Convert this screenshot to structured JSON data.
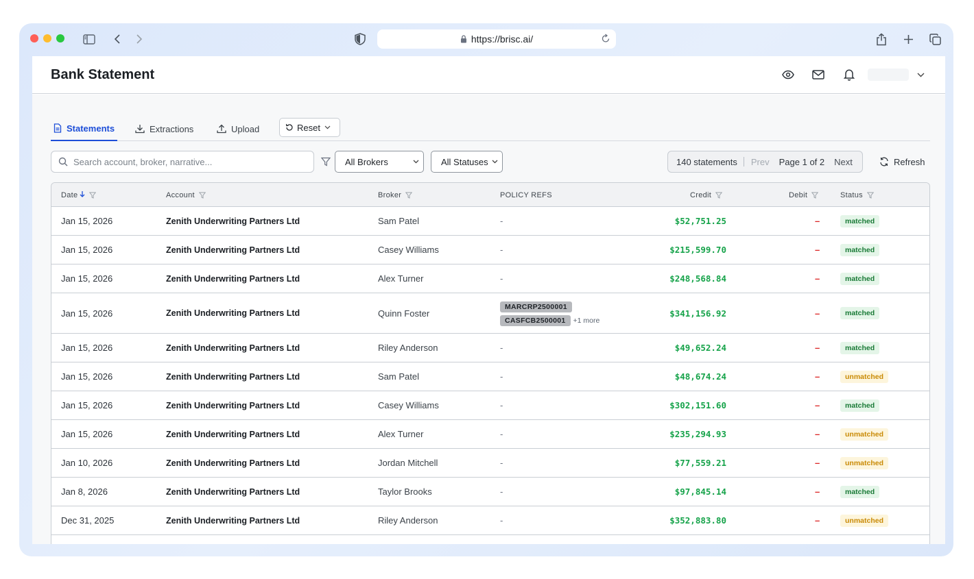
{
  "browser": {
    "url": "https://brisc.ai/"
  },
  "header": {
    "title": "Bank Statement"
  },
  "tabs": [
    {
      "label": "Statements",
      "active": true
    },
    {
      "label": "Extractions",
      "active": false
    },
    {
      "label": "Upload",
      "active": false
    }
  ],
  "toolbar": {
    "reset_label": "Reset",
    "search_placeholder": "Search account, broker, narrative...",
    "broker_filter": "All Brokers",
    "status_filter": "All Statuses",
    "statement_count": "140 statements",
    "prev_label": "Prev",
    "page_label": "Page 1 of 2",
    "next_label": "Next",
    "refresh_label": "Refresh"
  },
  "table": {
    "columns": {
      "date": "Date",
      "account": "Account",
      "broker": "Broker",
      "policy_refs": "POLICY REFS",
      "credit": "Credit",
      "debit": "Debit",
      "status": "Status"
    },
    "rows": [
      {
        "date": "Jan 15, 2026",
        "account": "Zenith Underwriting Partners Ltd",
        "broker": "Sam Patel",
        "policy": "-",
        "credit": "$52,751.25",
        "debit": "–",
        "status": "matched"
      },
      {
        "date": "Jan 15, 2026",
        "account": "Zenith Underwriting Partners Ltd",
        "broker": "Casey Williams",
        "policy": "-",
        "credit": "$215,599.70",
        "debit": "–",
        "status": "matched"
      },
      {
        "date": "Jan 15, 2026",
        "account": "Zenith Underwriting Partners Ltd",
        "broker": "Alex Turner",
        "policy": "-",
        "credit": "$248,568.84",
        "debit": "–",
        "status": "matched"
      },
      {
        "date": "Jan 15, 2026",
        "account": "Zenith Underwriting Partners Ltd",
        "broker": "Quinn Foster",
        "policy_refs": [
          "MARCRP2500001",
          "CASFCB2500001"
        ],
        "policy_more": "+1 more",
        "credit": "$341,156.92",
        "debit": "–",
        "status": "matched"
      },
      {
        "date": "Jan 15, 2026",
        "account": "Zenith Underwriting Partners Ltd",
        "broker": "Riley Anderson",
        "policy": "-",
        "credit": "$49,652.24",
        "debit": "–",
        "status": "matched"
      },
      {
        "date": "Jan 15, 2026",
        "account": "Zenith Underwriting Partners Ltd",
        "broker": "Sam Patel",
        "policy": "-",
        "credit": "$48,674.24",
        "debit": "–",
        "status": "unmatched"
      },
      {
        "date": "Jan 15, 2026",
        "account": "Zenith Underwriting Partners Ltd",
        "broker": "Casey Williams",
        "policy": "-",
        "credit": "$302,151.60",
        "debit": "–",
        "status": "matched"
      },
      {
        "date": "Jan 15, 2026",
        "account": "Zenith Underwriting Partners Ltd",
        "broker": "Alex Turner",
        "policy": "-",
        "credit": "$235,294.93",
        "debit": "–",
        "status": "unmatched"
      },
      {
        "date": "Jan 10, 2026",
        "account": "Zenith Underwriting Partners Ltd",
        "broker": "Jordan Mitchell",
        "policy": "-",
        "credit": "$77,559.21",
        "debit": "–",
        "status": "unmatched"
      },
      {
        "date": "Jan 8, 2026",
        "account": "Zenith Underwriting Partners Ltd",
        "broker": "Taylor Brooks",
        "policy": "-",
        "credit": "$97,845.14",
        "debit": "–",
        "status": "matched"
      },
      {
        "date": "Dec 31, 2025",
        "account": "Zenith Underwriting Partners Ltd",
        "broker": "Riley Anderson",
        "policy": "-",
        "credit": "$352,883.80",
        "debit": "–",
        "status": "unmatched"
      }
    ]
  },
  "colors": {
    "accent": "#1d4ed8",
    "credit": "#16a34a",
    "debit": "#dc2626",
    "matched_bg": "#e4f5e8",
    "unmatched_bg": "#fdf5dc"
  },
  "icons": {
    "header": [
      "eye-icon",
      "mail-icon",
      "bell-icon",
      "chevron-down-icon"
    ],
    "browser": [
      "sidebar-icon",
      "back-icon",
      "forward-icon",
      "shield-icon",
      "lock-icon",
      "reload-icon",
      "share-icon",
      "new-tab-icon",
      "tabs-icon"
    ]
  }
}
